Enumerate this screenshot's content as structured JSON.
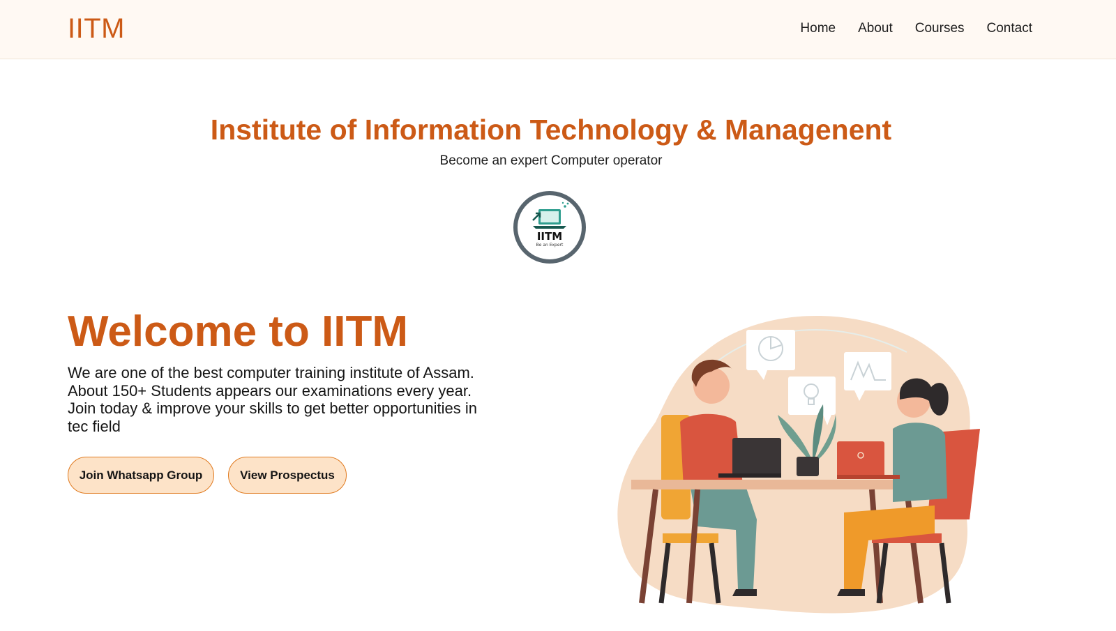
{
  "navbar": {
    "brand": "IITM",
    "links": [
      "Home",
      "About",
      "Courses",
      "Contact"
    ]
  },
  "hero": {
    "title": "Institute of Information Technology & Managenent",
    "subtitle": "Become an expert Computer operator",
    "logo": {
      "text": "IITM",
      "tagline": "Be an Expert"
    }
  },
  "welcome": {
    "heading": "Welcome to IITM",
    "lines": [
      "We are one of the best computer training institute of Assam.",
      "About 150+ Students appears our examinations every year.",
      "Join today & improve your skills to get better opportunities in",
      "tec field"
    ]
  },
  "buttons": {
    "whatsapp": "Join Whatsapp Group",
    "prospectus": "View Prospectus"
  },
  "colors": {
    "accent": "#cc5a16",
    "nav_bg": "#fff9f3",
    "button_bg": "#fde3c8",
    "button_border": "#e07a1f"
  }
}
